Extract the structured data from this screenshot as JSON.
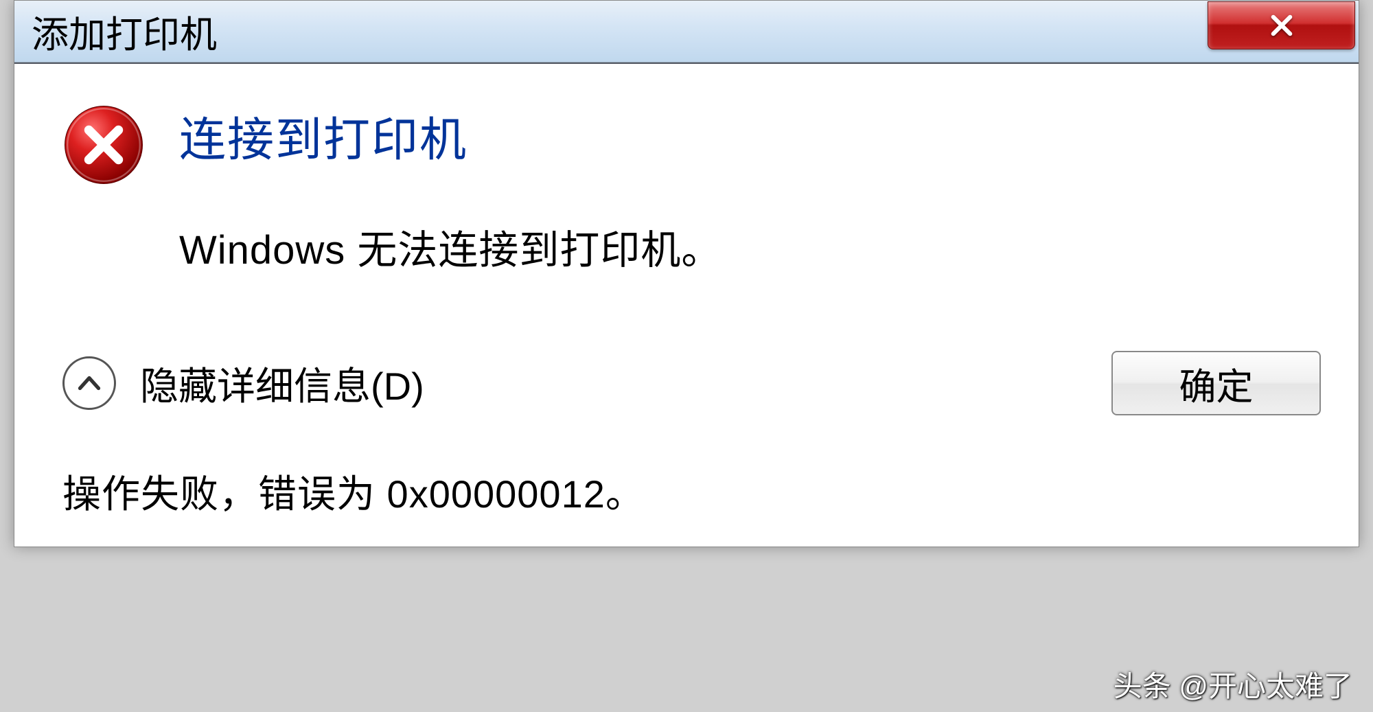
{
  "titlebar": {
    "title": "添加打印机"
  },
  "dialog": {
    "heading": "连接到打印机",
    "message": "Windows 无法连接到打印机。",
    "details_toggle_label": "隐藏详细信息(D)",
    "ok_button_label": "确定",
    "details_text": "操作失败，错误为 0x00000012。"
  },
  "watermark": "头条 @开心太难了"
}
